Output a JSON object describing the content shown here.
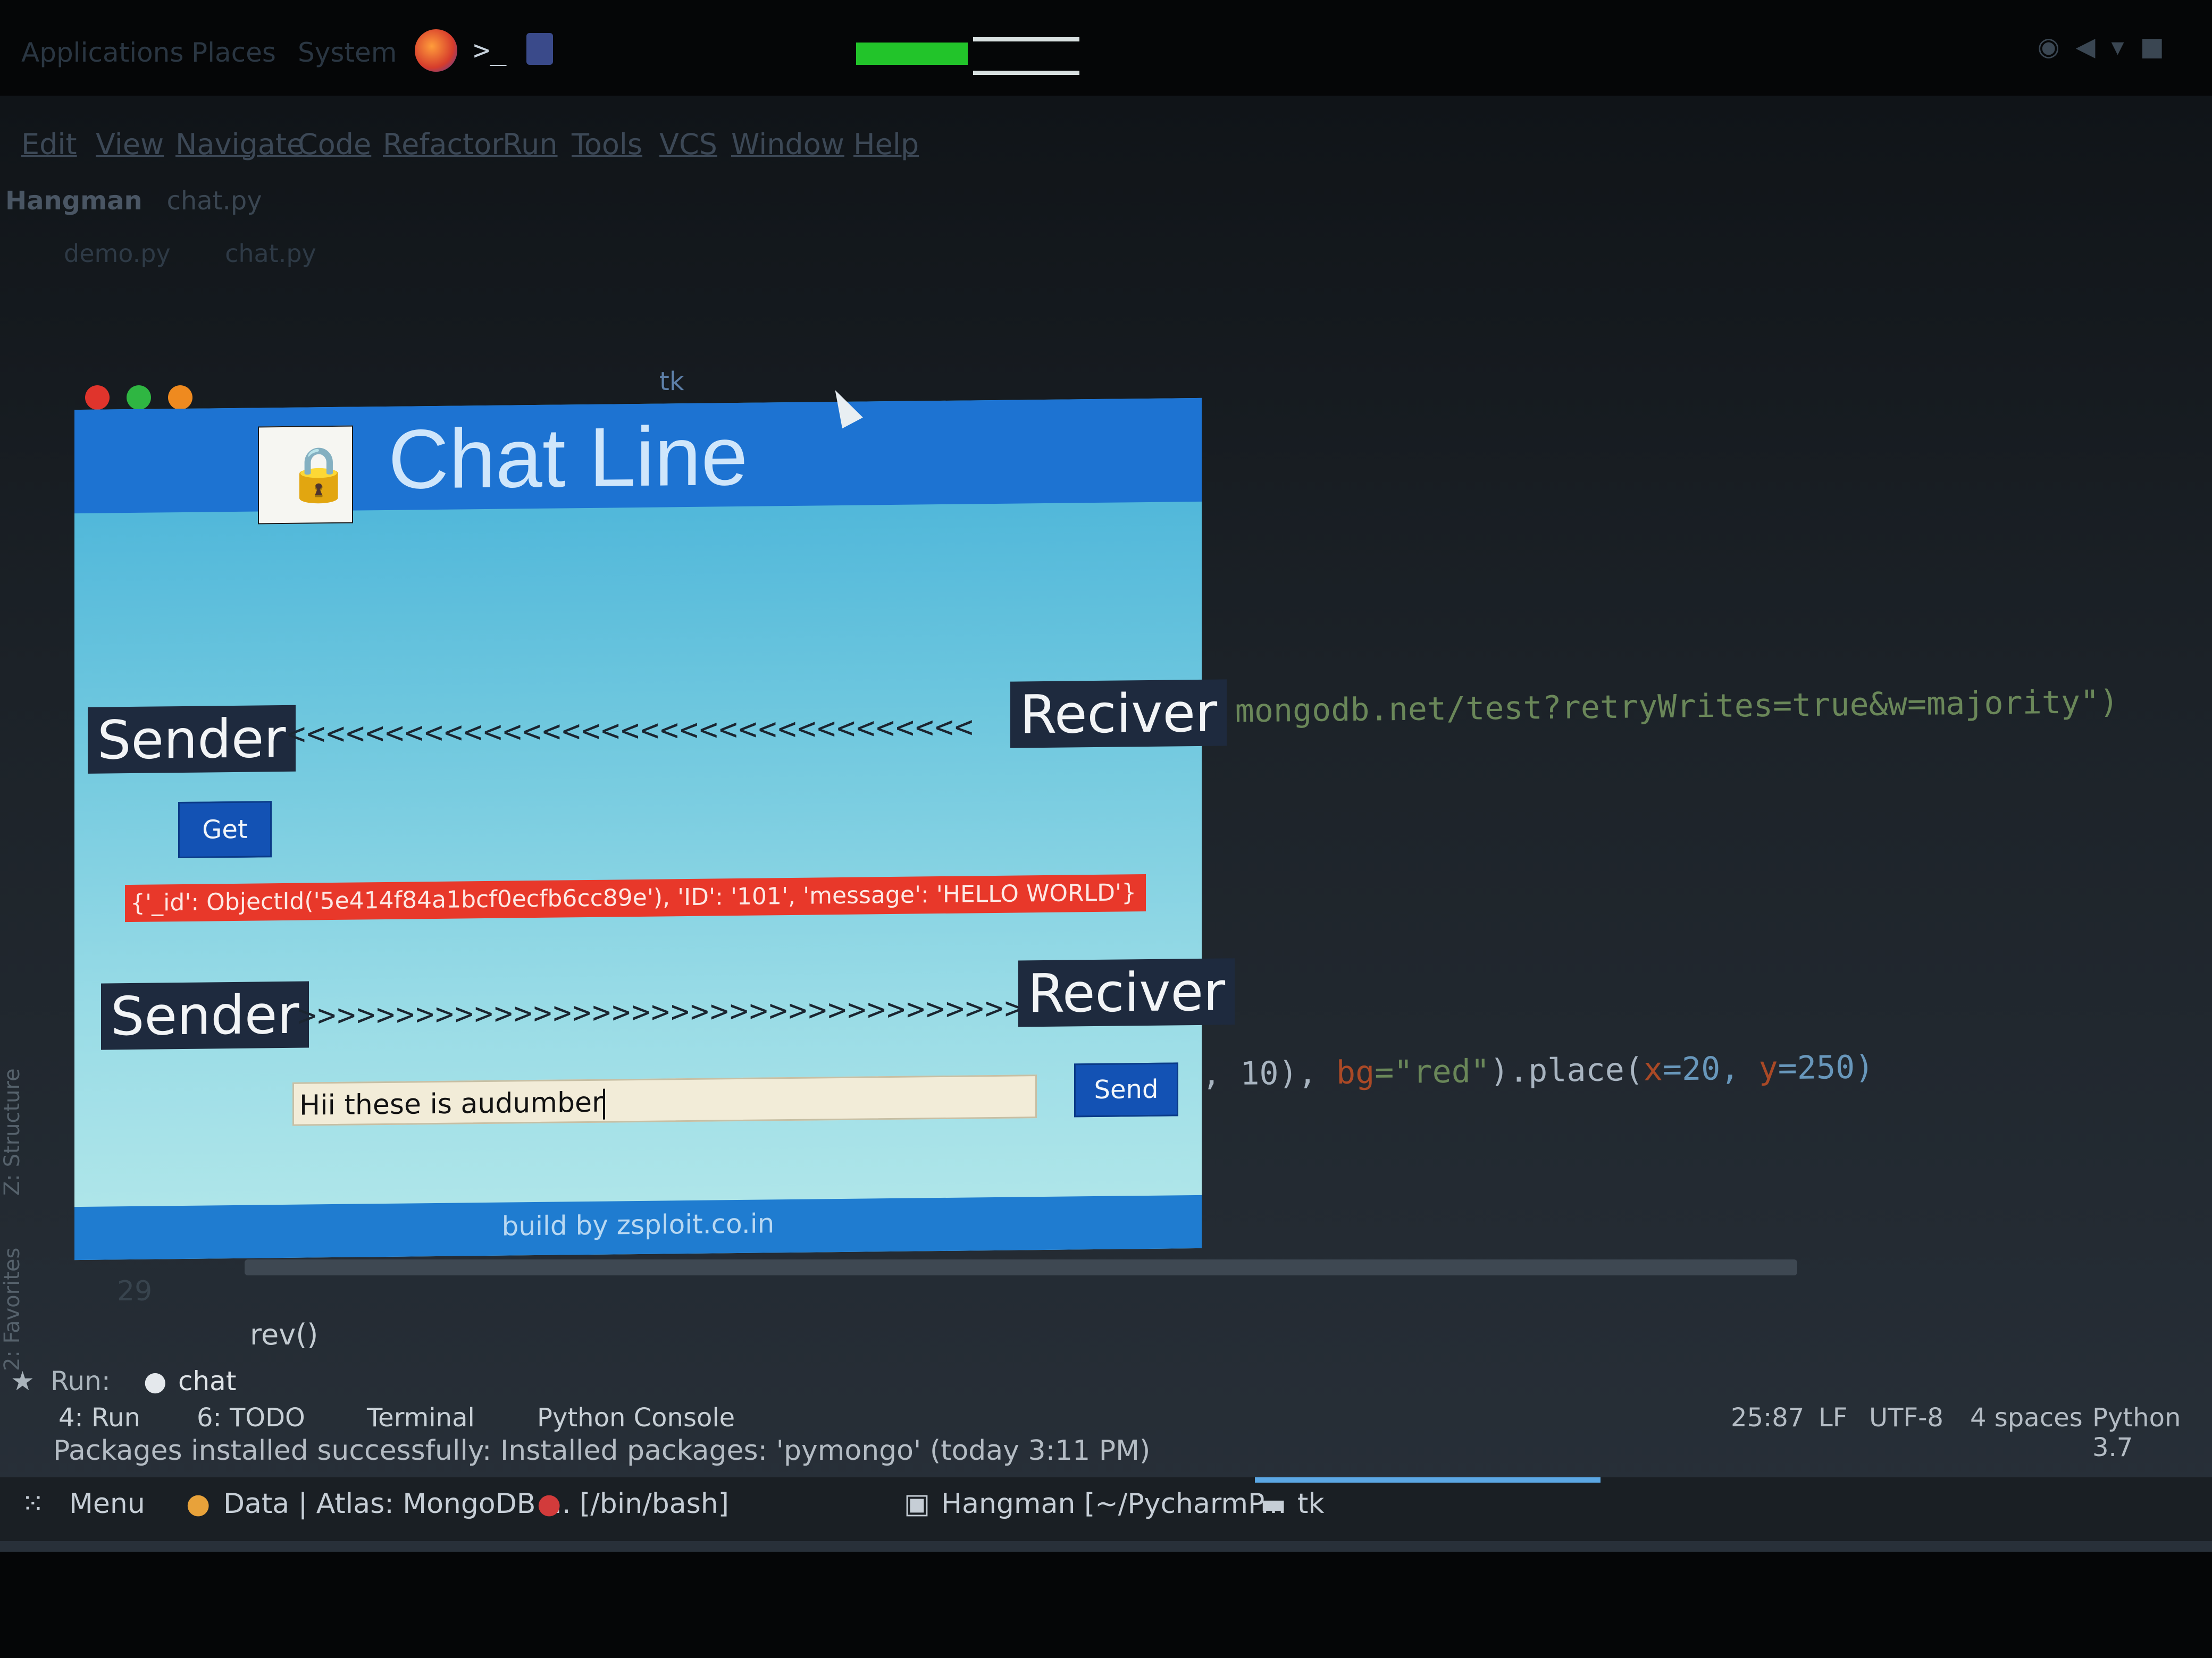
{
  "desktop_panel": {
    "menus": [
      "Applications",
      "Places",
      "System"
    ],
    "icons": [
      "firefox-icon",
      "terminal-icon",
      "files-icon"
    ]
  },
  "ide": {
    "menu": [
      "Edit",
      "View",
      "Navigate",
      "Code",
      "Refactor",
      "Run",
      "Tools",
      "VCS",
      "Window",
      "Help"
    ],
    "breadcrumb": {
      "project": "Hangman",
      "file": "chat.py"
    },
    "tabs": [
      "demo.py",
      "chat.py"
    ],
    "code_line_1": "mongodb.net/test?retryWrites=true&w=majority\")",
    "code_line_2_prefix": ", 10), ",
    "code_line_2_bg": "bg",
    "code_line_2_val": "=\"red\"",
    "code_line_2_place": ").place(",
    "code_line_2_x": "x",
    "code_line_2_xval": "=20, ",
    "code_line_2_y": "y",
    "code_line_2_yval": "=250)",
    "line_number": "29",
    "code_line_3": "rev()",
    "run_label": "Run:",
    "run_config": "chat",
    "tool_tabs": [
      "4: Run",
      "6: TODO",
      "Terminal",
      "Python Console"
    ],
    "status_message": "Packages installed successfully: Installed packages: 'pymongo' (today 3:11 PM)",
    "cursor_position": "25:87",
    "line_ending": "LF",
    "encoding": "UTF-8",
    "indent": "4 spaces",
    "interpreter": "Python 3.7",
    "side_labels": [
      "Z: Structure",
      "2: Favorites"
    ]
  },
  "tk_window": {
    "title": "tk",
    "banner_title": "Chat Line",
    "sender_label_1": "Sender",
    "receiver_label_1": "Reciver",
    "arrows_left": "<<<<<<<<<<<<<<<<<<<<<<<<<<<<<<<<<<<",
    "get_button": "Get",
    "received_message": "{'_id': ObjectId('5e414f84a1bcf0ecfb6cc89e'), 'ID': '101', 'message': 'HELLO WORLD'}",
    "sender_label_2": "Sender",
    "receiver_label_2": "Reciver",
    "arrows_right": ">>>>>>>>>>>>>>>>>>>>>>>>>>>>>>>>>>>>>",
    "message_input_value": "Hii these is audumber",
    "send_button": "Send",
    "footer": "build by zsploit.co.in"
  },
  "taskbar": {
    "menu": "Menu",
    "items": [
      "Data | Atlas: MongoDB ...",
      "[/bin/bash]",
      "Hangman [~/PycharmP...",
      "tk"
    ]
  },
  "colors": {
    "banner": "#1d73d2",
    "message_bg": "#e8382a",
    "button": "#1352b4",
    "label_bg": "#1e2a3e"
  }
}
